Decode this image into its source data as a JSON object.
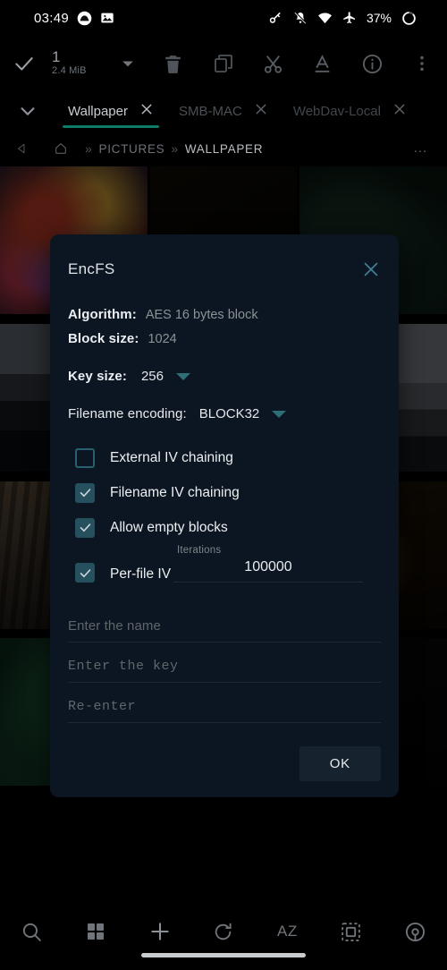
{
  "status_bar": {
    "time": "03:49",
    "battery": "37%",
    "left_icons": [
      "gallery-app-icon",
      "image-icon"
    ],
    "right_icons": [
      "vpn-key-icon",
      "notifications-off-icon",
      "wifi-icon",
      "airplane-mode-icon",
      "battery-circle-icon"
    ]
  },
  "toolbar": {
    "select_all_icon": "check-icon",
    "selected_count": "1",
    "selected_size": "2.4 MiB",
    "caret_icon": "chevron-down-icon",
    "actions": [
      {
        "name": "delete-button",
        "icon": "trash-icon"
      },
      {
        "name": "copy-button",
        "icon": "copy-icon"
      },
      {
        "name": "cut-button",
        "icon": "scissors-icon"
      },
      {
        "name": "rename-button",
        "icon": "text-format-icon"
      },
      {
        "name": "info-button",
        "icon": "info-circle-icon"
      },
      {
        "name": "overflow-menu-button",
        "icon": "dots-vertical-icon"
      }
    ]
  },
  "tabs": {
    "expand_icon": "chevron-down-icon",
    "items": [
      {
        "label": "Wallpaper",
        "active": true
      },
      {
        "label": "SMB-MAC",
        "active": false
      },
      {
        "label": "WebDav-Local",
        "active": false
      }
    ],
    "close_icon": "close-icon",
    "active_underline_color": "#0e7a6a"
  },
  "breadcrumb": {
    "back_icon": "back-triangle-icon",
    "home_icon": "home-icon",
    "separator": "»",
    "segments": [
      "PICTURES",
      "WALLPAPER"
    ],
    "overflow": "…"
  },
  "dialog": {
    "title": "EncFS",
    "close_icon": "close-icon",
    "close_color": "#3f7f93",
    "accent_color": "#2e6e77",
    "background_color": "#0c1622",
    "properties": [
      {
        "label": "Algorithm:",
        "value": "AES 16 bytes block",
        "has_dropdown": false
      },
      {
        "label": "Block size:",
        "value": "1024",
        "has_dropdown": false
      },
      {
        "label": "Key size:",
        "value": "256",
        "has_dropdown": true
      }
    ],
    "filename_encoding": {
      "label": "Filename encoding:",
      "value": "BLOCK32",
      "has_dropdown": true
    },
    "checkboxes": [
      {
        "label": "External IV chaining",
        "checked": false
      },
      {
        "label": "Filename IV chaining",
        "checked": true
      },
      {
        "label": "Allow empty blocks",
        "checked": true
      },
      {
        "label": "Per-file IV",
        "checked": true
      }
    ],
    "iterations": {
      "label": "Iterations",
      "value": "100000"
    },
    "fields": [
      {
        "name": "name-field",
        "placeholder": "Enter the name",
        "value": "",
        "mono": false
      },
      {
        "name": "key-field",
        "placeholder": "Enter the key",
        "value": "",
        "mono": true
      },
      {
        "name": "key-confirm-field",
        "placeholder": "Re-enter",
        "value": "",
        "mono": true
      }
    ],
    "ok_label": "OK"
  },
  "bottom_bar": {
    "items": [
      {
        "name": "search-button",
        "icon": "search-icon",
        "label": ""
      },
      {
        "name": "view-mode-button",
        "icon": "grid-icon",
        "label": ""
      },
      {
        "name": "add-button",
        "icon": "plus-icon",
        "label": ""
      },
      {
        "name": "refresh-button",
        "icon": "refresh-icon",
        "label": ""
      },
      {
        "name": "sort-button",
        "icon": "az-sort-icon",
        "label": "AZ"
      },
      {
        "name": "select-button",
        "icon": "select-all-icon",
        "label": ""
      },
      {
        "name": "network-button",
        "icon": "broadcast-icon",
        "label": ""
      }
    ]
  }
}
